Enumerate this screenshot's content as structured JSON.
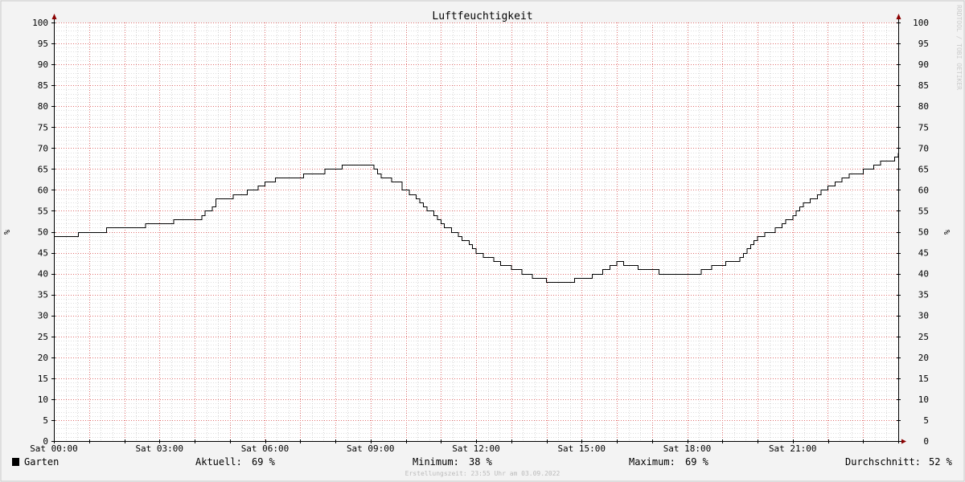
{
  "chart_data": {
    "type": "line",
    "title": "Luftfeuchtigkeit",
    "ylabel": "%",
    "xlabel": "",
    "ylim": [
      0,
      100
    ],
    "xlim": [
      0,
      24
    ],
    "y_ticks": [
      0,
      5,
      10,
      15,
      20,
      25,
      30,
      35,
      40,
      45,
      50,
      55,
      60,
      65,
      70,
      75,
      80,
      85,
      90,
      95,
      100
    ],
    "x_ticks": [
      {
        "value": 0,
        "label": "Sat 00:00"
      },
      {
        "value": 3,
        "label": "Sat 03:00"
      },
      {
        "value": 6,
        "label": "Sat 06:00"
      },
      {
        "value": 9,
        "label": "Sat 09:00"
      },
      {
        "value": 12,
        "label": "Sat 12:00"
      },
      {
        "value": 15,
        "label": "Sat 15:00"
      },
      {
        "value": 18,
        "label": "Sat 18:00"
      },
      {
        "value": 21,
        "label": "Sat 21:00"
      }
    ],
    "grid": true,
    "step": true,
    "series": [
      {
        "name": "Garten",
        "color": "#000000",
        "x": [
          0,
          0.7,
          1.1,
          1.4,
          1.5,
          1.9,
          2.6,
          3.4,
          4.2,
          4.3,
          4.5,
          4.6,
          4.8,
          5.1,
          5.5,
          5.8,
          6.0,
          6.3,
          6.7,
          7.1,
          7.3,
          7.7,
          8.2,
          8.6,
          8.9,
          9.1,
          9.2,
          9.3,
          9.6,
          9.9,
          10.1,
          10.3,
          10.4,
          10.5,
          10.6,
          10.8,
          10.9,
          11.0,
          11.1,
          11.3,
          11.5,
          11.6,
          11.8,
          11.9,
          12.0,
          12.2,
          12.3,
          12.5,
          12.7,
          12.8,
          13.0,
          13.3,
          13.6,
          14.0,
          14.3,
          14.5,
          14.7,
          14.8,
          15.0,
          15.3,
          15.6,
          15.8,
          16.0,
          16.2,
          16.6,
          16.9,
          17.2,
          18.1,
          18.4,
          18.7,
          19.1,
          19.3,
          19.5,
          19.6,
          19.7,
          19.8,
          19.9,
          20.0,
          20.2,
          20.5,
          20.7,
          20.8,
          20.9,
          21.0,
          21.1,
          21.2,
          21.3,
          21.5,
          21.7,
          21.8,
          22.0,
          22.2,
          22.4,
          22.6,
          23.0,
          23.3,
          23.5,
          23.9,
          24
        ],
        "values": [
          49,
          50,
          50,
          50,
          51,
          51,
          52,
          53,
          54,
          55,
          56,
          58,
          58,
          59,
          60,
          61,
          62,
          63,
          63,
          64,
          64,
          65,
          66,
          66,
          66,
          65,
          64,
          63,
          62,
          60,
          59,
          58,
          57,
          56,
          55,
          54,
          53,
          52,
          51,
          50,
          49,
          48,
          47,
          46,
          45,
          44,
          44,
          43,
          42,
          42,
          41,
          40,
          39,
          38,
          38,
          38,
          38,
          39,
          39,
          40,
          41,
          42,
          43,
          42,
          41,
          41,
          40,
          40,
          41,
          42,
          43,
          43,
          44,
          45,
          46,
          47,
          48,
          49,
          50,
          51,
          52,
          53,
          53,
          54,
          55,
          56,
          57,
          58,
          59,
          60,
          61,
          62,
          63,
          64,
          65,
          66,
          67,
          68,
          69
        ]
      }
    ]
  },
  "legend": {
    "series_name": "Garten",
    "aktuell_label": "Aktuell:",
    "aktuell_value": "69 %",
    "minimum_label": "Minimum:",
    "minimum_value": "38 %",
    "maximum_label": "Maximum:",
    "maximum_value": "69 %",
    "durchschnitt_label": "Durchschnitt:",
    "durchschnitt_value": "52 %"
  },
  "footer": {
    "timestamp": "Erstellungszeit: 23:55 Uhr am 03.09.2022"
  },
  "watermark": "RRDTOOL / TOBI OETIKER",
  "colors": {
    "background": "#f3f3f3",
    "plot_background": "#ffffff",
    "major_grid": "#e07070",
    "minor_grid": "#bbbbbb",
    "axis": "#000000",
    "arrow": "#8b0000",
    "line": "#000000"
  }
}
